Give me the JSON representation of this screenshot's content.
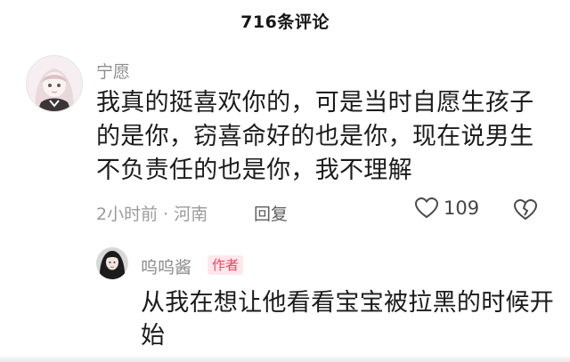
{
  "header": {
    "title": "716条评论"
  },
  "comment": {
    "username": "宁愿",
    "text": "我真的挺喜欢你的，可是当时自愿生孩子的是你，窃喜命好的也是你，现在说男生不负责任的也是你，我不理解",
    "meta": "2小时前 · 河南",
    "reply_label": "回复",
    "like_count": "109",
    "like_icon": "heart-outline-icon",
    "dislike_icon": "broken-heart-icon"
  },
  "reply": {
    "username": "呜呜酱",
    "badge": "作者",
    "text": "从我在想让他看看宝宝被拉黑的时候开始"
  },
  "colors": {
    "accent": "#f0435e",
    "badge_bg": "#ffe8ec",
    "muted": "#9b9b9b"
  }
}
